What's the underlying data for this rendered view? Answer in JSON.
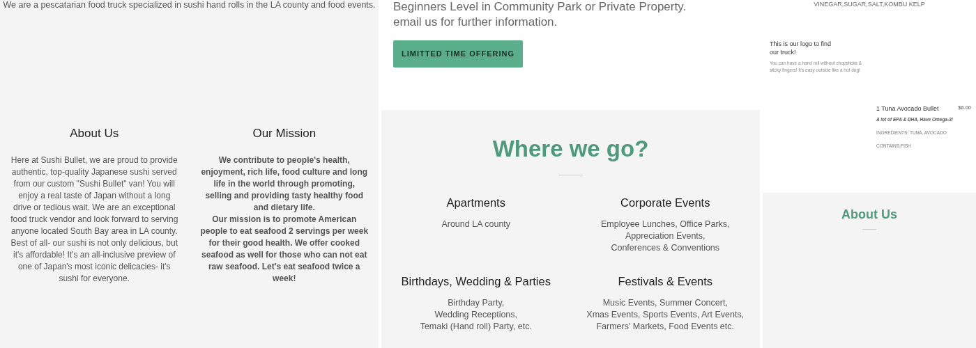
{
  "left": {
    "intro": "We are a pescatarian food truck specialized in sushi hand rolls in the LA county and food events.",
    "columns": [
      {
        "heading": "About Us",
        "body": "Here at Sushi Bullet, we are proud to provide authentic, top-quality Japanese sushi served from our custom \"Sushi Bullet\" van! You will enjoy a real taste of Japan without a long drive or tedious wait. We are an exceptional food truck vendor and look forward to serving anyone located South Bay area in LA county. Best of all- our sushi is not only delicious, but it's affordable! It's an all-inclusive preview of one of Japan's most iconic delicacies- it's sushi for everyone.",
        "bold": false
      },
      {
        "heading": "Our Mission",
        "body": "We contribute to people's health, enjoyment, rich life, food culture and long life in the world through promoting, selling and providing tasty healthy food and dietary life.\nOur mission is to promote American people to eat seafood 2 servings per week for their good health. We offer cooked seafood as well for those who can not eat raw seafood. Let's eat seafood twice a week!",
        "bold": true
      }
    ]
  },
  "middle": {
    "lines": [
      "Beginners Level in Community Park or Private Property.",
      "email us for further information."
    ],
    "button": "LIMITTED TIME OFFERING",
    "title": "Where we go?",
    "places": [
      {
        "heading": "Apartments",
        "lines": [
          "Around LA county"
        ]
      },
      {
        "heading": "Corporate Events",
        "lines": [
          "Employee Lunches, Office Parks,",
          "Appreciation Events,",
          "Conferences & Conventions"
        ]
      },
      {
        "heading": "Birthdays, Wedding & Parties",
        "lines": [
          "Birthday Party,",
          "Wedding Receptions,",
          "Temaki (Hand roll) Party, etc."
        ]
      },
      {
        "heading": "Festivals & Events",
        "lines": [
          "Music Events, Summer Concert,",
          "Xmas Events, Sports Events, Art Events,",
          "Farmers' Markets, Food Events etc."
        ]
      }
    ]
  },
  "right": {
    "ingredients": "VINEGAR,SUGAR,SALT,KOMBU KELP",
    "logo_title": "This is our logo to find our truck!",
    "logo_text": "You can have a hand roll without chopsticks & sticky fingers! It's easy outside like a hot dog!",
    "item": {
      "name": "1 Tuna Avocado Bullet",
      "price": "$6.00",
      "tagline": "A lot of EPA & DHA, Have Omega-3!",
      "details": [
        "INGREDIENTS: TUNA, AVOCADO",
        "CONTAINS:FISH"
      ]
    },
    "title": "About Us"
  }
}
